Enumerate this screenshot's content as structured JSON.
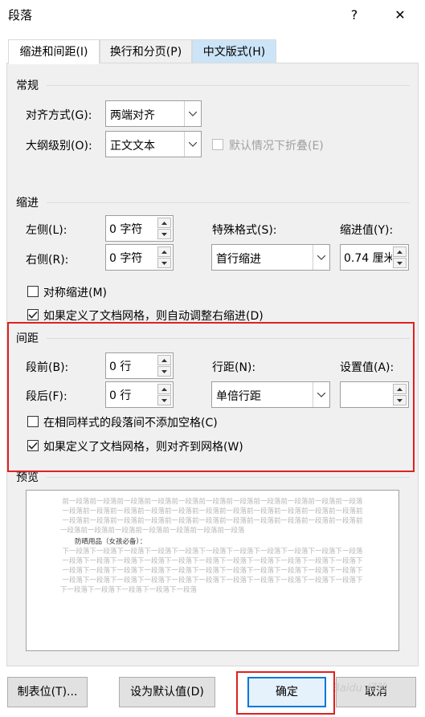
{
  "window": {
    "title": "段落",
    "help_label": "?",
    "close_label": "✕"
  },
  "tabs": [
    {
      "label": "缩进和间距(I)"
    },
    {
      "label": "换行和分页(P)"
    },
    {
      "label": "中文版式(H)"
    }
  ],
  "general": {
    "section_label": "常规",
    "alignment_label": "对齐方式(G):",
    "alignment_value": "两端对齐",
    "outline_label": "大纲级别(O):",
    "outline_value": "正文文本",
    "collapse_label": "默认情况下折叠(E)"
  },
  "indent": {
    "section_label": "缩进",
    "left_label": "左侧(L):",
    "left_value": "0 字符",
    "right_label": "右侧(R):",
    "right_value": "0 字符",
    "special_label": "特殊格式(S):",
    "special_value": "首行缩进",
    "by_label": "缩进值(Y):",
    "by_value": "0.74 厘米",
    "mirror_label": "对称缩进(M)",
    "auto_adjust_label": "如果定义了文档网格，则自动调整右缩进(D)"
  },
  "spacing": {
    "section_label": "间距",
    "before_label": "段前(B):",
    "before_value": "0 行",
    "after_label": "段后(F):",
    "after_value": "0 行",
    "line_label": "行距(N):",
    "line_value": "单倍行距",
    "at_label": "设置值(A):",
    "at_value": "",
    "no_space_label": "在相同样式的段落间不添加空格(C)",
    "snap_grid_label": "如果定义了文档网格，则对齐到网格(W)"
  },
  "preview": {
    "section_label": "预览",
    "prev_lines": [
      "前一段落前一段落前一段落前一段落前一段落前一段落前一段落前一段落前一段落前一段落前一段落",
      "一段落前一段落前一段落前一段落前一段落前一段落前一段落前一段落前一段落前一段落前一段落前",
      "一段落前一段落前一段落前一段落前一段落前一段落前一段落前一段落前一段落前一段落前一段落前",
      "一段落前一段落前一段落前一段落前一段落前一段落前一段落"
    ],
    "sample_text": "防晒用品（女孩必备）：",
    "next_lines": [
      "下一段落下一段落下一段落下一段落下一段落下一段落下一段落下一段落下一段落下一段落下一段落",
      "一段落下一段落下一段落下一段落下一段落下一段落下一段落下一段落下一段落下一段落下一段落下",
      "一段落下一段落下一段落下一段落下一段落下一段落下一段落下一段落下一段落下一段落下一段落下",
      "一段落下一段落下一段落下一段落下一段落下一段落下一段落下一段落下一段落下一段落下一段落下",
      "下一段落下一段落下一段落下一段落下一段落"
    ]
  },
  "buttons": {
    "tabs_label": "制表位(T)...",
    "default_label": "设为默认值(D)",
    "ok_label": "确定",
    "cancel_label": "取消"
  },
  "watermark": {
    "text": "Baidu 经验"
  },
  "colors": {
    "highlight_box": "#e02020",
    "accent": "#0078d7"
  }
}
